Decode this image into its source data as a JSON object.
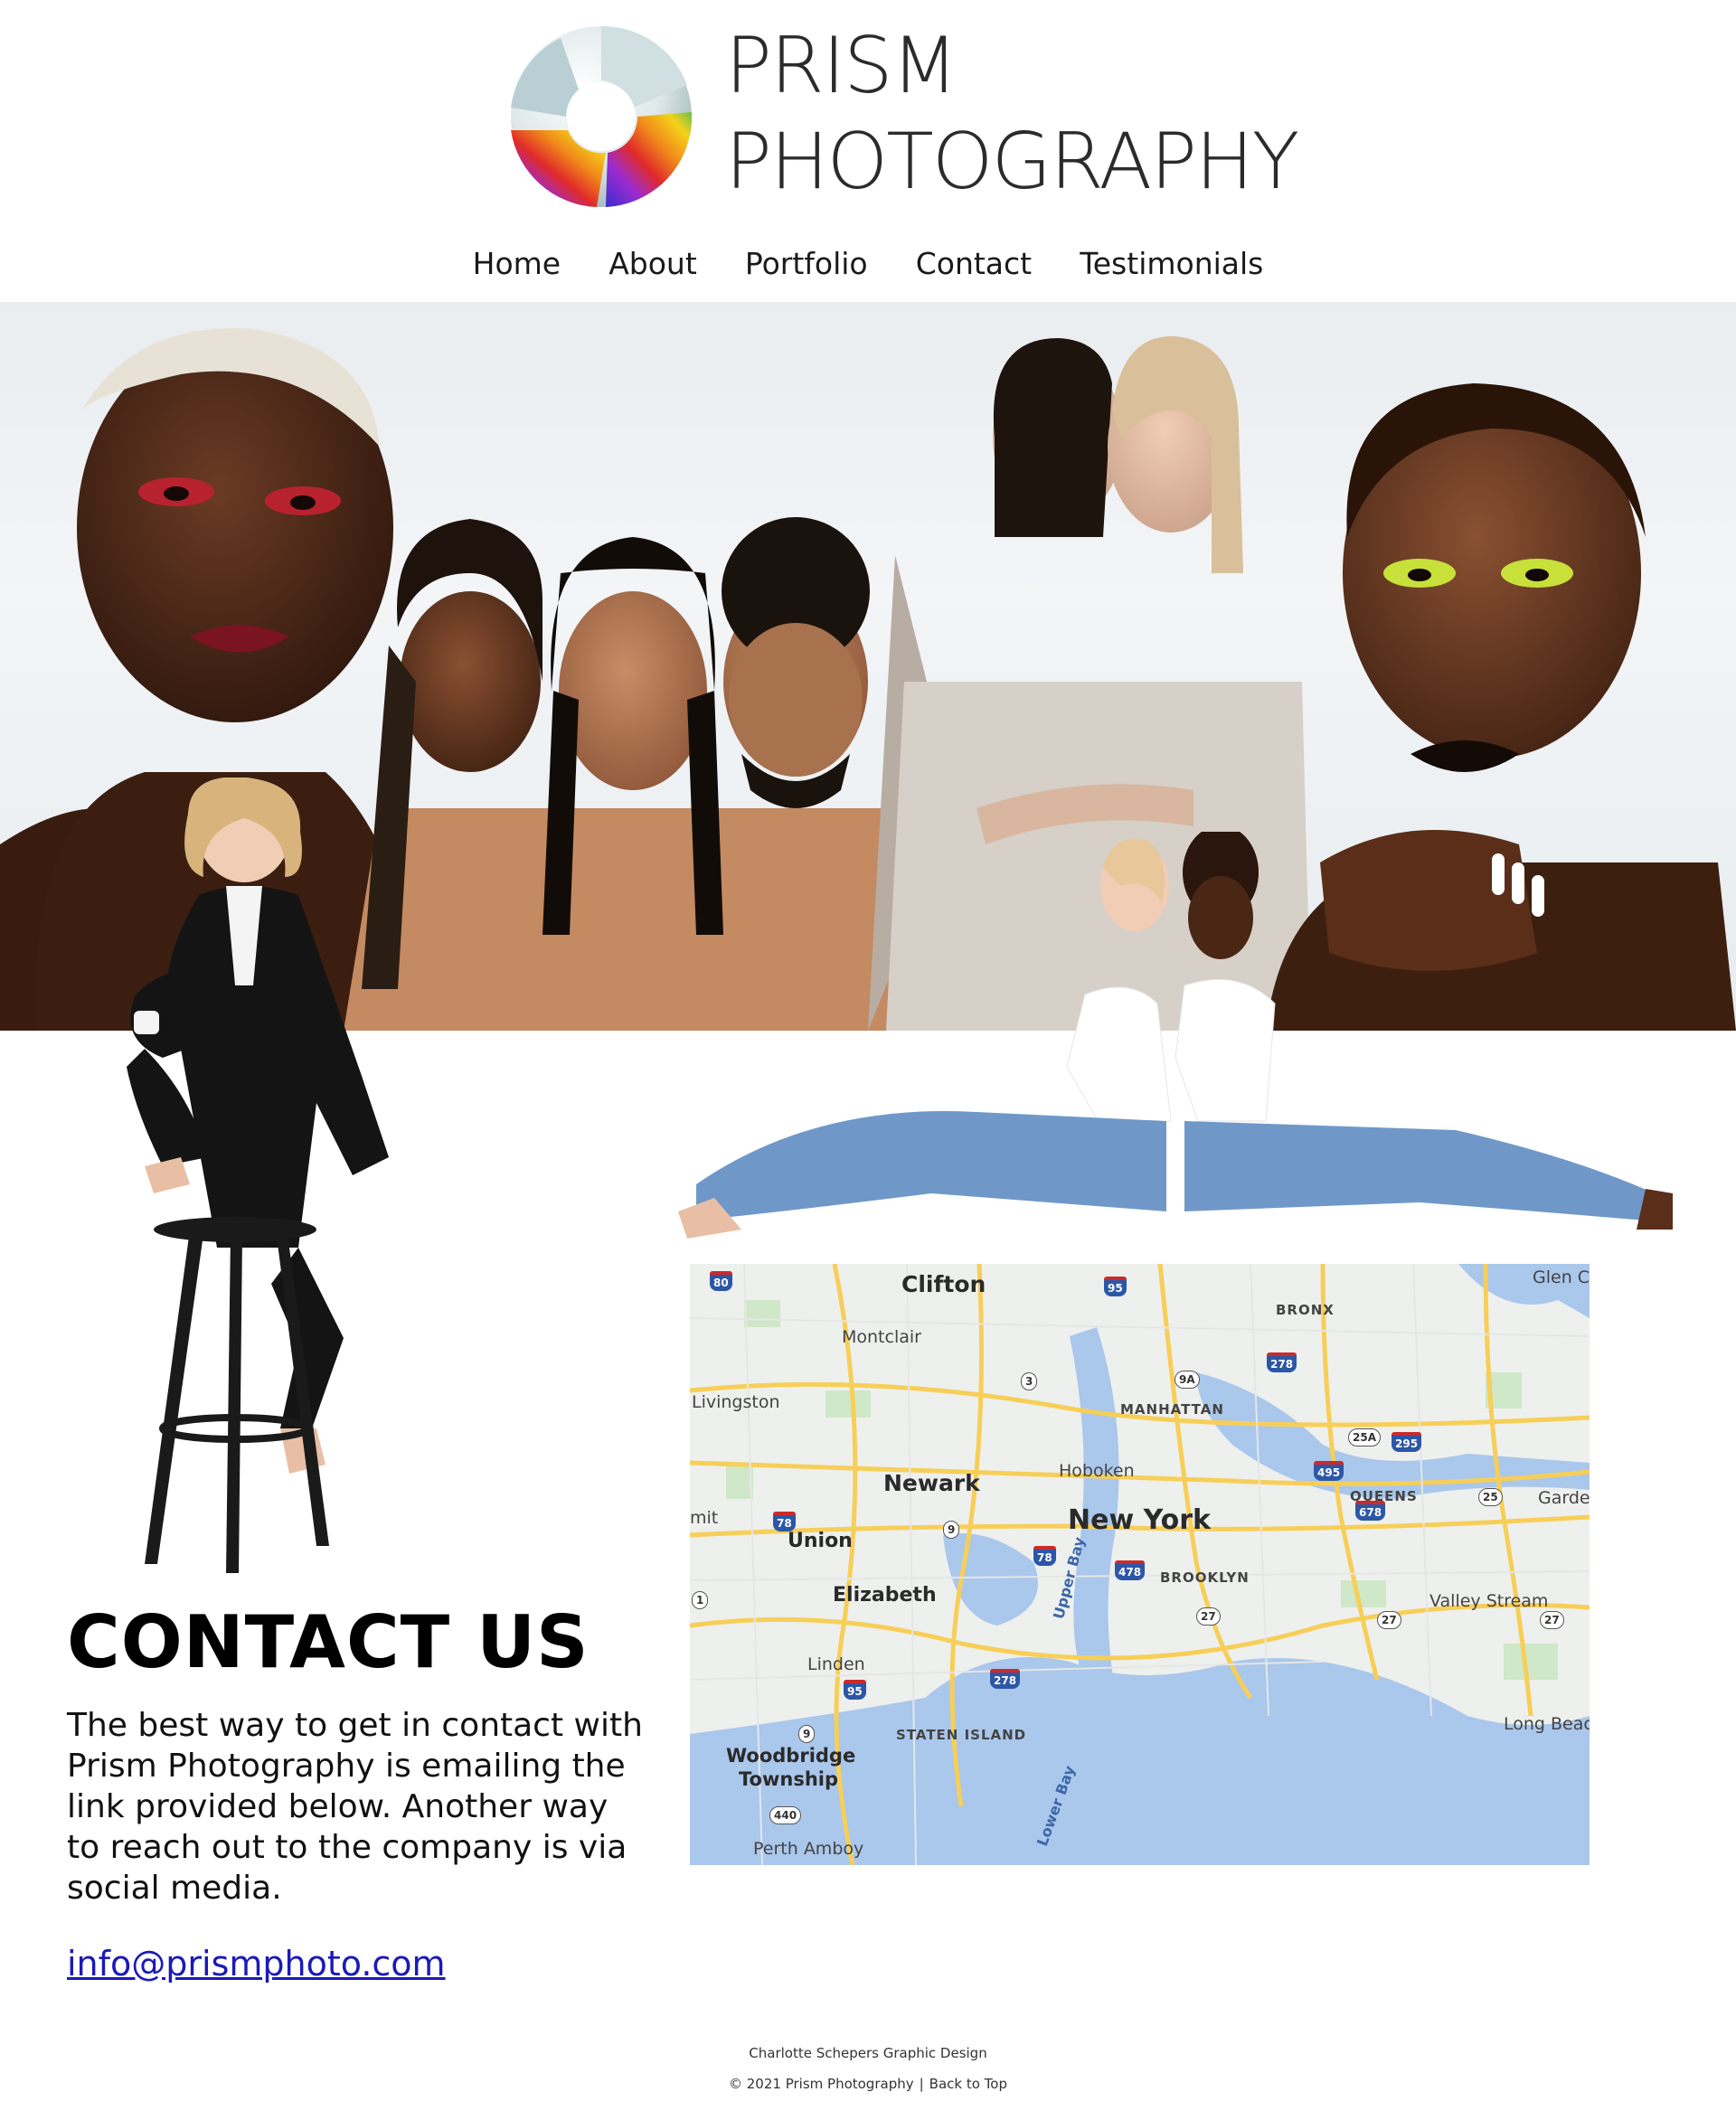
{
  "brand": {
    "line1": "PRISM",
    "line2": "PHOTOGRAPHY"
  },
  "nav": {
    "items": [
      "Home",
      "About",
      "Portfolio",
      "Contact",
      "Testimonials"
    ]
  },
  "map": {
    "cities": [
      "Clifton",
      "Montclair",
      "Livingston",
      "Newark",
      "Hoboken",
      "New York",
      "Union",
      "Elizabeth",
      "Linden",
      "Woodbridge",
      "Township",
      "Perth Amboy",
      "Valley Stream",
      "Long Beac",
      "Glen C",
      "Garden",
      "mit"
    ],
    "boroughs": [
      "BRONX",
      "MANHATTAN",
      "QUEENS",
      "BROOKLYN",
      "STATEN ISLAND"
    ],
    "water": [
      "Upper Bay",
      "Lower Bay"
    ],
    "shields": [
      "80",
      "95",
      "3",
      "9A",
      "278",
      "25A",
      "295",
      "495",
      "678",
      "25",
      "78",
      "9",
      "78",
      "478",
      "27",
      "27",
      "27",
      "95",
      "278",
      "9",
      "440",
      "1"
    ]
  },
  "contact": {
    "title": "CONTACT US",
    "body": "The best way to get in contact with Prism Photography is emailing the link provided below. Another way to reach out to the company is via social media.",
    "email": "info@prismphoto.com"
  },
  "footer": {
    "credit": "Charlotte Schepers Graphic Design",
    "copyright": "© 2021 Prism Photography",
    "separator": "|",
    "back_to_top": "Back to Top"
  }
}
